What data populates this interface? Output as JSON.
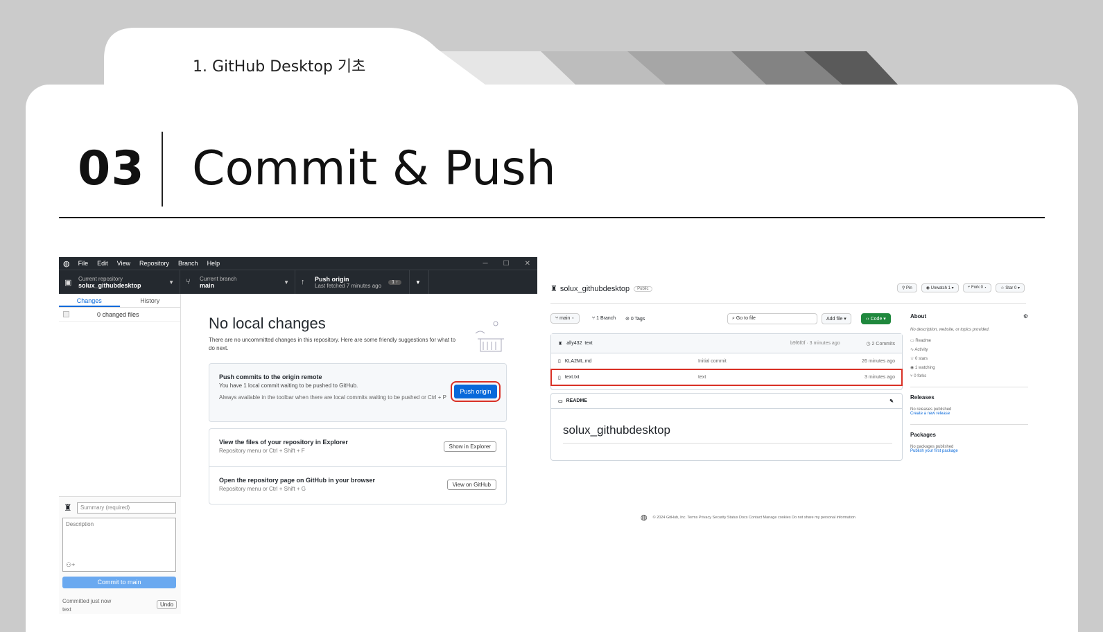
{
  "slide": {
    "section_title": "1. GitHub Desktop 기초",
    "number": "03",
    "heading": "Commit & Push"
  },
  "desktop": {
    "menu": [
      "File",
      "Edit",
      "View",
      "Repository",
      "Branch",
      "Help"
    ],
    "current_repo_label": "Current repository",
    "current_repo": "solux_githubdesktop",
    "current_branch_label": "Current branch",
    "current_branch": "main",
    "push_label": "Push origin",
    "last_fetched": "Last fetched 7 minutes ago",
    "push_badge": "1 ↑",
    "tab_changes": "Changes",
    "tab_history": "History",
    "changed_files": "0 changed files",
    "summary_placeholder": "Summary (required)",
    "description_placeholder": "Description",
    "commit_button": "Commit to main",
    "committed": "Committed just now",
    "committed_msg": "text",
    "undo": "Undo",
    "no_changes_title": "No local changes",
    "no_changes_desc": "There are no uncommitted changes in this repository. Here are some friendly suggestions for what to do next.",
    "push_box_title": "Push commits to the origin remote",
    "push_box_desc": "You have 1 local commit waiting to be pushed to GitHub.",
    "push_box_hint": "Always available in the toolbar when there are local commits waiting to be pushed or  Ctrl + P",
    "push_button": "Push origin",
    "explorer_title": "View the files of your repository in Explorer",
    "explorer_hint": "Repository menu or  Ctrl + Shift + F",
    "explorer_button": "Show in Explorer",
    "github_title": "Open the repository page on GitHub in your browser",
    "github_hint": "Repository menu or  Ctrl + Shift + G",
    "github_button": "View on GitHub"
  },
  "web": {
    "repo": "solux_githubdesktop",
    "visibility": "Public",
    "pin": "Pin",
    "unwatch": "Unwatch  1",
    "fork": "Fork  0",
    "star": "Star  0",
    "branch": "main",
    "branches": "1 Branch",
    "tags": "0 Tags",
    "goto": "Go to file",
    "addfile": "Add file",
    "code": "Code",
    "last_user": "ally432",
    "last_msg": "text",
    "last_hash": "b9f6f0f · 3 minutes ago",
    "commits": "2 Commits",
    "files": [
      {
        "name": "KLA2ML.md",
        "msg": "Initial commit",
        "time": "26 minutes ago"
      },
      {
        "name": "text.txt",
        "msg": "text",
        "time": "3 minutes ago"
      }
    ],
    "readme_label": "README",
    "readme_title": "solux_githubdesktop",
    "about": "About",
    "about_desc": "No description, website, or topics provided.",
    "about_items": [
      "Readme",
      "Activity",
      "0 stars",
      "1 watching",
      "0 forks"
    ],
    "releases": "Releases",
    "releases_none": "No releases published",
    "releases_link": "Create a new release",
    "packages": "Packages",
    "packages_none": "No packages published",
    "packages_link": "Publish your first package",
    "footer": "© 2024 GitHub, Inc.   Terms   Privacy   Security   Status   Docs   Contact   Manage cookies   Do not share my personal information"
  }
}
